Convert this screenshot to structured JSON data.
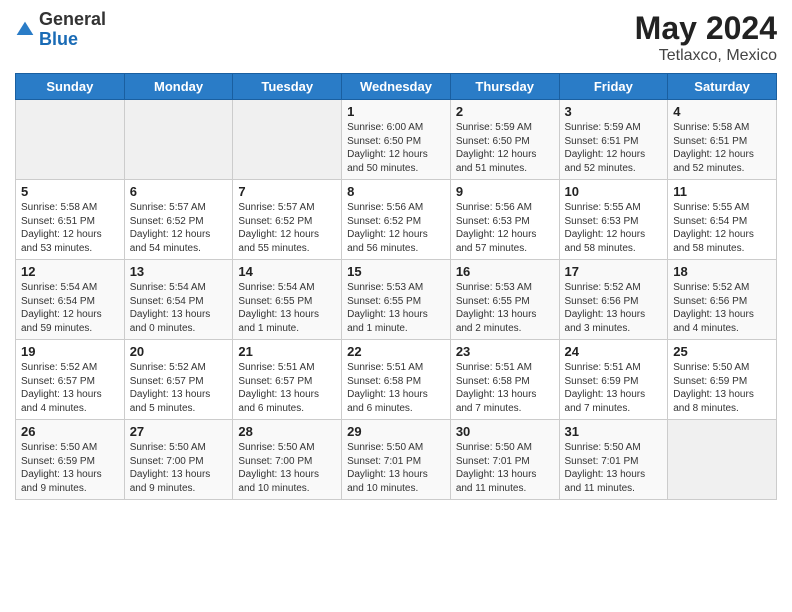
{
  "header": {
    "logo_general": "General",
    "logo_blue": "Blue",
    "month_year": "May 2024",
    "location": "Tetlaxco, Mexico"
  },
  "days_of_week": [
    "Sunday",
    "Monday",
    "Tuesday",
    "Wednesday",
    "Thursday",
    "Friday",
    "Saturday"
  ],
  "weeks": [
    [
      {
        "day": "",
        "info": "",
        "empty": true
      },
      {
        "day": "",
        "info": "",
        "empty": true
      },
      {
        "day": "",
        "info": "",
        "empty": true
      },
      {
        "day": "1",
        "info": "Sunrise: 6:00 AM\nSunset: 6:50 PM\nDaylight: 12 hours\nand 50 minutes."
      },
      {
        "day": "2",
        "info": "Sunrise: 5:59 AM\nSunset: 6:50 PM\nDaylight: 12 hours\nand 51 minutes."
      },
      {
        "day": "3",
        "info": "Sunrise: 5:59 AM\nSunset: 6:51 PM\nDaylight: 12 hours\nand 52 minutes."
      },
      {
        "day": "4",
        "info": "Sunrise: 5:58 AM\nSunset: 6:51 PM\nDaylight: 12 hours\nand 52 minutes."
      }
    ],
    [
      {
        "day": "5",
        "info": "Sunrise: 5:58 AM\nSunset: 6:51 PM\nDaylight: 12 hours\nand 53 minutes."
      },
      {
        "day": "6",
        "info": "Sunrise: 5:57 AM\nSunset: 6:52 PM\nDaylight: 12 hours\nand 54 minutes."
      },
      {
        "day": "7",
        "info": "Sunrise: 5:57 AM\nSunset: 6:52 PM\nDaylight: 12 hours\nand 55 minutes."
      },
      {
        "day": "8",
        "info": "Sunrise: 5:56 AM\nSunset: 6:52 PM\nDaylight: 12 hours\nand 56 minutes."
      },
      {
        "day": "9",
        "info": "Sunrise: 5:56 AM\nSunset: 6:53 PM\nDaylight: 12 hours\nand 57 minutes."
      },
      {
        "day": "10",
        "info": "Sunrise: 5:55 AM\nSunset: 6:53 PM\nDaylight: 12 hours\nand 58 minutes."
      },
      {
        "day": "11",
        "info": "Sunrise: 5:55 AM\nSunset: 6:54 PM\nDaylight: 12 hours\nand 58 minutes."
      }
    ],
    [
      {
        "day": "12",
        "info": "Sunrise: 5:54 AM\nSunset: 6:54 PM\nDaylight: 12 hours\nand 59 minutes."
      },
      {
        "day": "13",
        "info": "Sunrise: 5:54 AM\nSunset: 6:54 PM\nDaylight: 13 hours\nand 0 minutes."
      },
      {
        "day": "14",
        "info": "Sunrise: 5:54 AM\nSunset: 6:55 PM\nDaylight: 13 hours\nand 1 minute."
      },
      {
        "day": "15",
        "info": "Sunrise: 5:53 AM\nSunset: 6:55 PM\nDaylight: 13 hours\nand 1 minute."
      },
      {
        "day": "16",
        "info": "Sunrise: 5:53 AM\nSunset: 6:55 PM\nDaylight: 13 hours\nand 2 minutes."
      },
      {
        "day": "17",
        "info": "Sunrise: 5:52 AM\nSunset: 6:56 PM\nDaylight: 13 hours\nand 3 minutes."
      },
      {
        "day": "18",
        "info": "Sunrise: 5:52 AM\nSunset: 6:56 PM\nDaylight: 13 hours\nand 4 minutes."
      }
    ],
    [
      {
        "day": "19",
        "info": "Sunrise: 5:52 AM\nSunset: 6:57 PM\nDaylight: 13 hours\nand 4 minutes."
      },
      {
        "day": "20",
        "info": "Sunrise: 5:52 AM\nSunset: 6:57 PM\nDaylight: 13 hours\nand 5 minutes."
      },
      {
        "day": "21",
        "info": "Sunrise: 5:51 AM\nSunset: 6:57 PM\nDaylight: 13 hours\nand 6 minutes."
      },
      {
        "day": "22",
        "info": "Sunrise: 5:51 AM\nSunset: 6:58 PM\nDaylight: 13 hours\nand 6 minutes."
      },
      {
        "day": "23",
        "info": "Sunrise: 5:51 AM\nSunset: 6:58 PM\nDaylight: 13 hours\nand 7 minutes."
      },
      {
        "day": "24",
        "info": "Sunrise: 5:51 AM\nSunset: 6:59 PM\nDaylight: 13 hours\nand 7 minutes."
      },
      {
        "day": "25",
        "info": "Sunrise: 5:50 AM\nSunset: 6:59 PM\nDaylight: 13 hours\nand 8 minutes."
      }
    ],
    [
      {
        "day": "26",
        "info": "Sunrise: 5:50 AM\nSunset: 6:59 PM\nDaylight: 13 hours\nand 9 minutes."
      },
      {
        "day": "27",
        "info": "Sunrise: 5:50 AM\nSunset: 7:00 PM\nDaylight: 13 hours\nand 9 minutes."
      },
      {
        "day": "28",
        "info": "Sunrise: 5:50 AM\nSunset: 7:00 PM\nDaylight: 13 hours\nand 10 minutes."
      },
      {
        "day": "29",
        "info": "Sunrise: 5:50 AM\nSunset: 7:01 PM\nDaylight: 13 hours\nand 10 minutes."
      },
      {
        "day": "30",
        "info": "Sunrise: 5:50 AM\nSunset: 7:01 PM\nDaylight: 13 hours\nand 11 minutes."
      },
      {
        "day": "31",
        "info": "Sunrise: 5:50 AM\nSunset: 7:01 PM\nDaylight: 13 hours\nand 11 minutes."
      },
      {
        "day": "",
        "info": "",
        "empty": true
      }
    ]
  ]
}
